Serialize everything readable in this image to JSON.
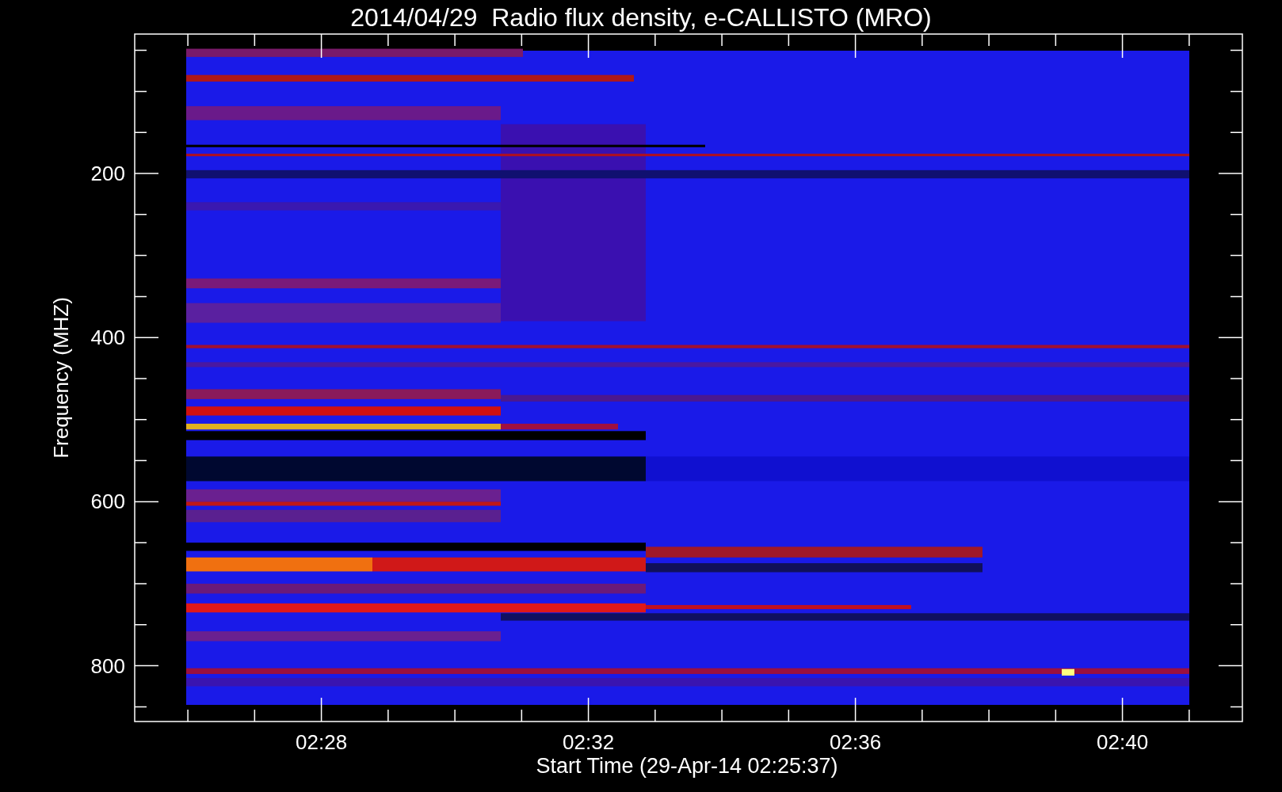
{
  "title": "2014/04/29  Radio flux density, e-CALLISTO (MRO)",
  "ylabel": "Frequency (MHZ)",
  "xlabel": "Start Time (29-Apr-14 02:25:37)",
  "yticks": [
    "200",
    "400",
    "600",
    "800"
  ],
  "xticks": [
    "02:28",
    "02:32",
    "02:36",
    "02:40"
  ]
}
